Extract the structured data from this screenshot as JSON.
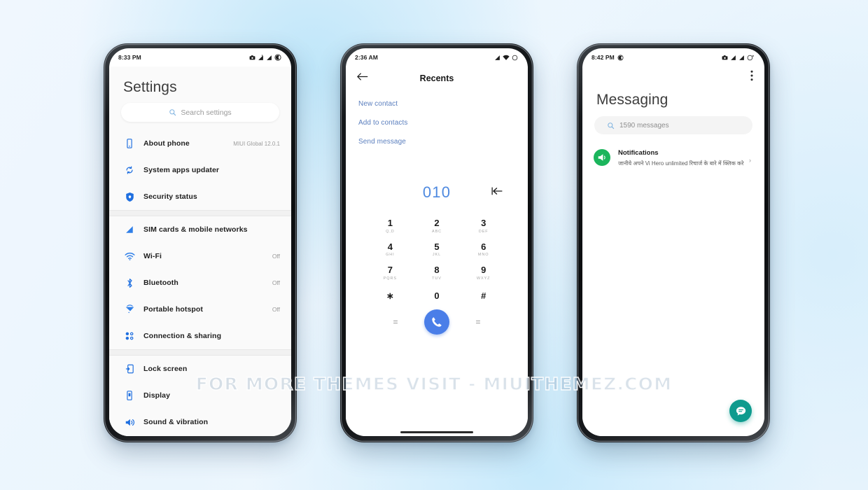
{
  "watermark": "FOR MORE THEMES VISIT - MIUITHEMEZ.COM",
  "colors": {
    "accent_blue": "#4f8ae0",
    "call_button": "#4a7ee8",
    "messaging_fab": "#0e9b8e",
    "avatar_green": "#1bb55c",
    "settings_icon_blue": "#1f6fe0",
    "link_blue": "#5b7fbe",
    "background": "#eef6fd"
  },
  "settings_phone": {
    "status_bar": {
      "time": "8:33 PM",
      "icons": [
        "camera-icon",
        "signal-bars-icon",
        "signal-bars-icon",
        "do-not-disturb-icon"
      ]
    },
    "title": "Settings",
    "search": {
      "placeholder": "Search settings",
      "icon": "search-icon"
    },
    "groups": [
      {
        "items": [
          {
            "label": "About phone",
            "value": "MIUI Global 12.0.1",
            "icon": "phone-device-icon"
          },
          {
            "label": "System apps updater",
            "value": "",
            "icon": "refresh-icon"
          },
          {
            "label": "Security status",
            "value": "",
            "icon": "shield-icon"
          }
        ]
      },
      {
        "items": [
          {
            "label": "SIM cards & mobile networks",
            "value": "",
            "icon": "signal-icon"
          },
          {
            "label": "Wi-Fi",
            "value": "Off",
            "icon": "wifi-icon"
          },
          {
            "label": "Bluetooth",
            "value": "Off",
            "icon": "bluetooth-icon"
          },
          {
            "label": "Portable hotspot",
            "value": "Off",
            "icon": "hotspot-icon"
          },
          {
            "label": "Connection & sharing",
            "value": "",
            "icon": "connection-sharing-icon"
          }
        ]
      },
      {
        "items": [
          {
            "label": "Lock screen",
            "value": "",
            "icon": "lock-screen-icon"
          },
          {
            "label": "Display",
            "value": "",
            "icon": "display-icon"
          },
          {
            "label": "Sound & vibration",
            "value": "",
            "icon": "sound-icon"
          }
        ]
      }
    ]
  },
  "dialer_phone": {
    "status_bar": {
      "time": "2:36 AM",
      "icons": [
        "signal-bars-icon",
        "wifi-icon",
        "battery-icon"
      ]
    },
    "header": {
      "title": "Recents",
      "back_icon": "back-arrow-icon"
    },
    "actions": [
      "New contact",
      "Add to contacts",
      "Send message"
    ],
    "dialed_number": "010",
    "backspace_icon": "backspace-icon",
    "keypad": [
      [
        {
          "digit": "1",
          "sub": "Q,D"
        },
        {
          "digit": "2",
          "sub": "ABC"
        },
        {
          "digit": "3",
          "sub": "DEF"
        }
      ],
      [
        {
          "digit": "4",
          "sub": "GHI"
        },
        {
          "digit": "5",
          "sub": "JKL"
        },
        {
          "digit": "6",
          "sub": "MNO"
        }
      ],
      [
        {
          "digit": "7",
          "sub": "PQRS"
        },
        {
          "digit": "8",
          "sub": "TUV"
        },
        {
          "digit": "9",
          "sub": "WXYZ"
        }
      ],
      [
        {
          "digit": "∗",
          "sub": ""
        },
        {
          "digit": "0",
          "sub": ""
        },
        {
          "digit": "#",
          "sub": ""
        }
      ]
    ],
    "bottom_row": {
      "left_label": "=",
      "right_label": "=",
      "call_icon": "phone-call-icon"
    }
  },
  "messaging_phone": {
    "status_bar": {
      "time": "8:42 PM",
      "left_icon": "do-not-disturb-icon",
      "icons": [
        "camera-icon",
        "signal-bars-icon",
        "signal-bars-icon",
        "battery-charging-icon"
      ]
    },
    "overflow_icon": "more-vertical-icon",
    "title": "Messaging",
    "search": {
      "placeholder": "1590 messages",
      "icon": "search-icon"
    },
    "conversations": [
      {
        "name": "Notifications",
        "snippet": "जानीये अपने Vi Hero unlimited रिचार्ज के बारे में क्लिक करे",
        "avatar_icon": "megaphone-icon",
        "chevron": "›"
      }
    ],
    "fab": {
      "icon": "new-message-icon"
    }
  }
}
